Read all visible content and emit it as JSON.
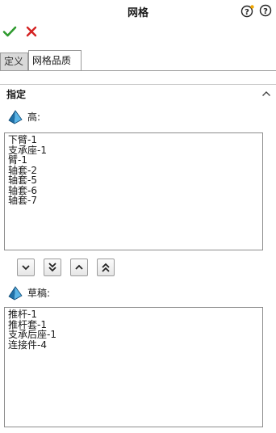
{
  "panel": {
    "title": "网格"
  },
  "tabs": [
    {
      "label": "定义",
      "active": false
    },
    {
      "label": "网格品质",
      "active": true
    }
  ],
  "section": {
    "title": "指定"
  },
  "high": {
    "label": "高:",
    "items": [
      "下臂-1",
      "支承座-1",
      "臂-1",
      "轴套-2",
      "轴套-5",
      "轴套-6",
      "轴套-7"
    ]
  },
  "draft": {
    "label": "草稿:",
    "items": [
      "推杆-1",
      "推杆套-1",
      "支承后座-1",
      "连接件-4"
    ]
  },
  "icons": {
    "ok": "checkmark-icon",
    "cancel": "x-icon",
    "help": "question-mark-icon",
    "help2": "question-mark-icon",
    "order": [
      "move-down-icon",
      "move-to-bottom-icon",
      "move-up-icon",
      "move-to-top-icon"
    ],
    "group": "pyramid-mesh-icon"
  },
  "colors": {
    "ok": "#2e9a2e",
    "cancel": "#d42222",
    "accent": "#2a8cc8"
  }
}
